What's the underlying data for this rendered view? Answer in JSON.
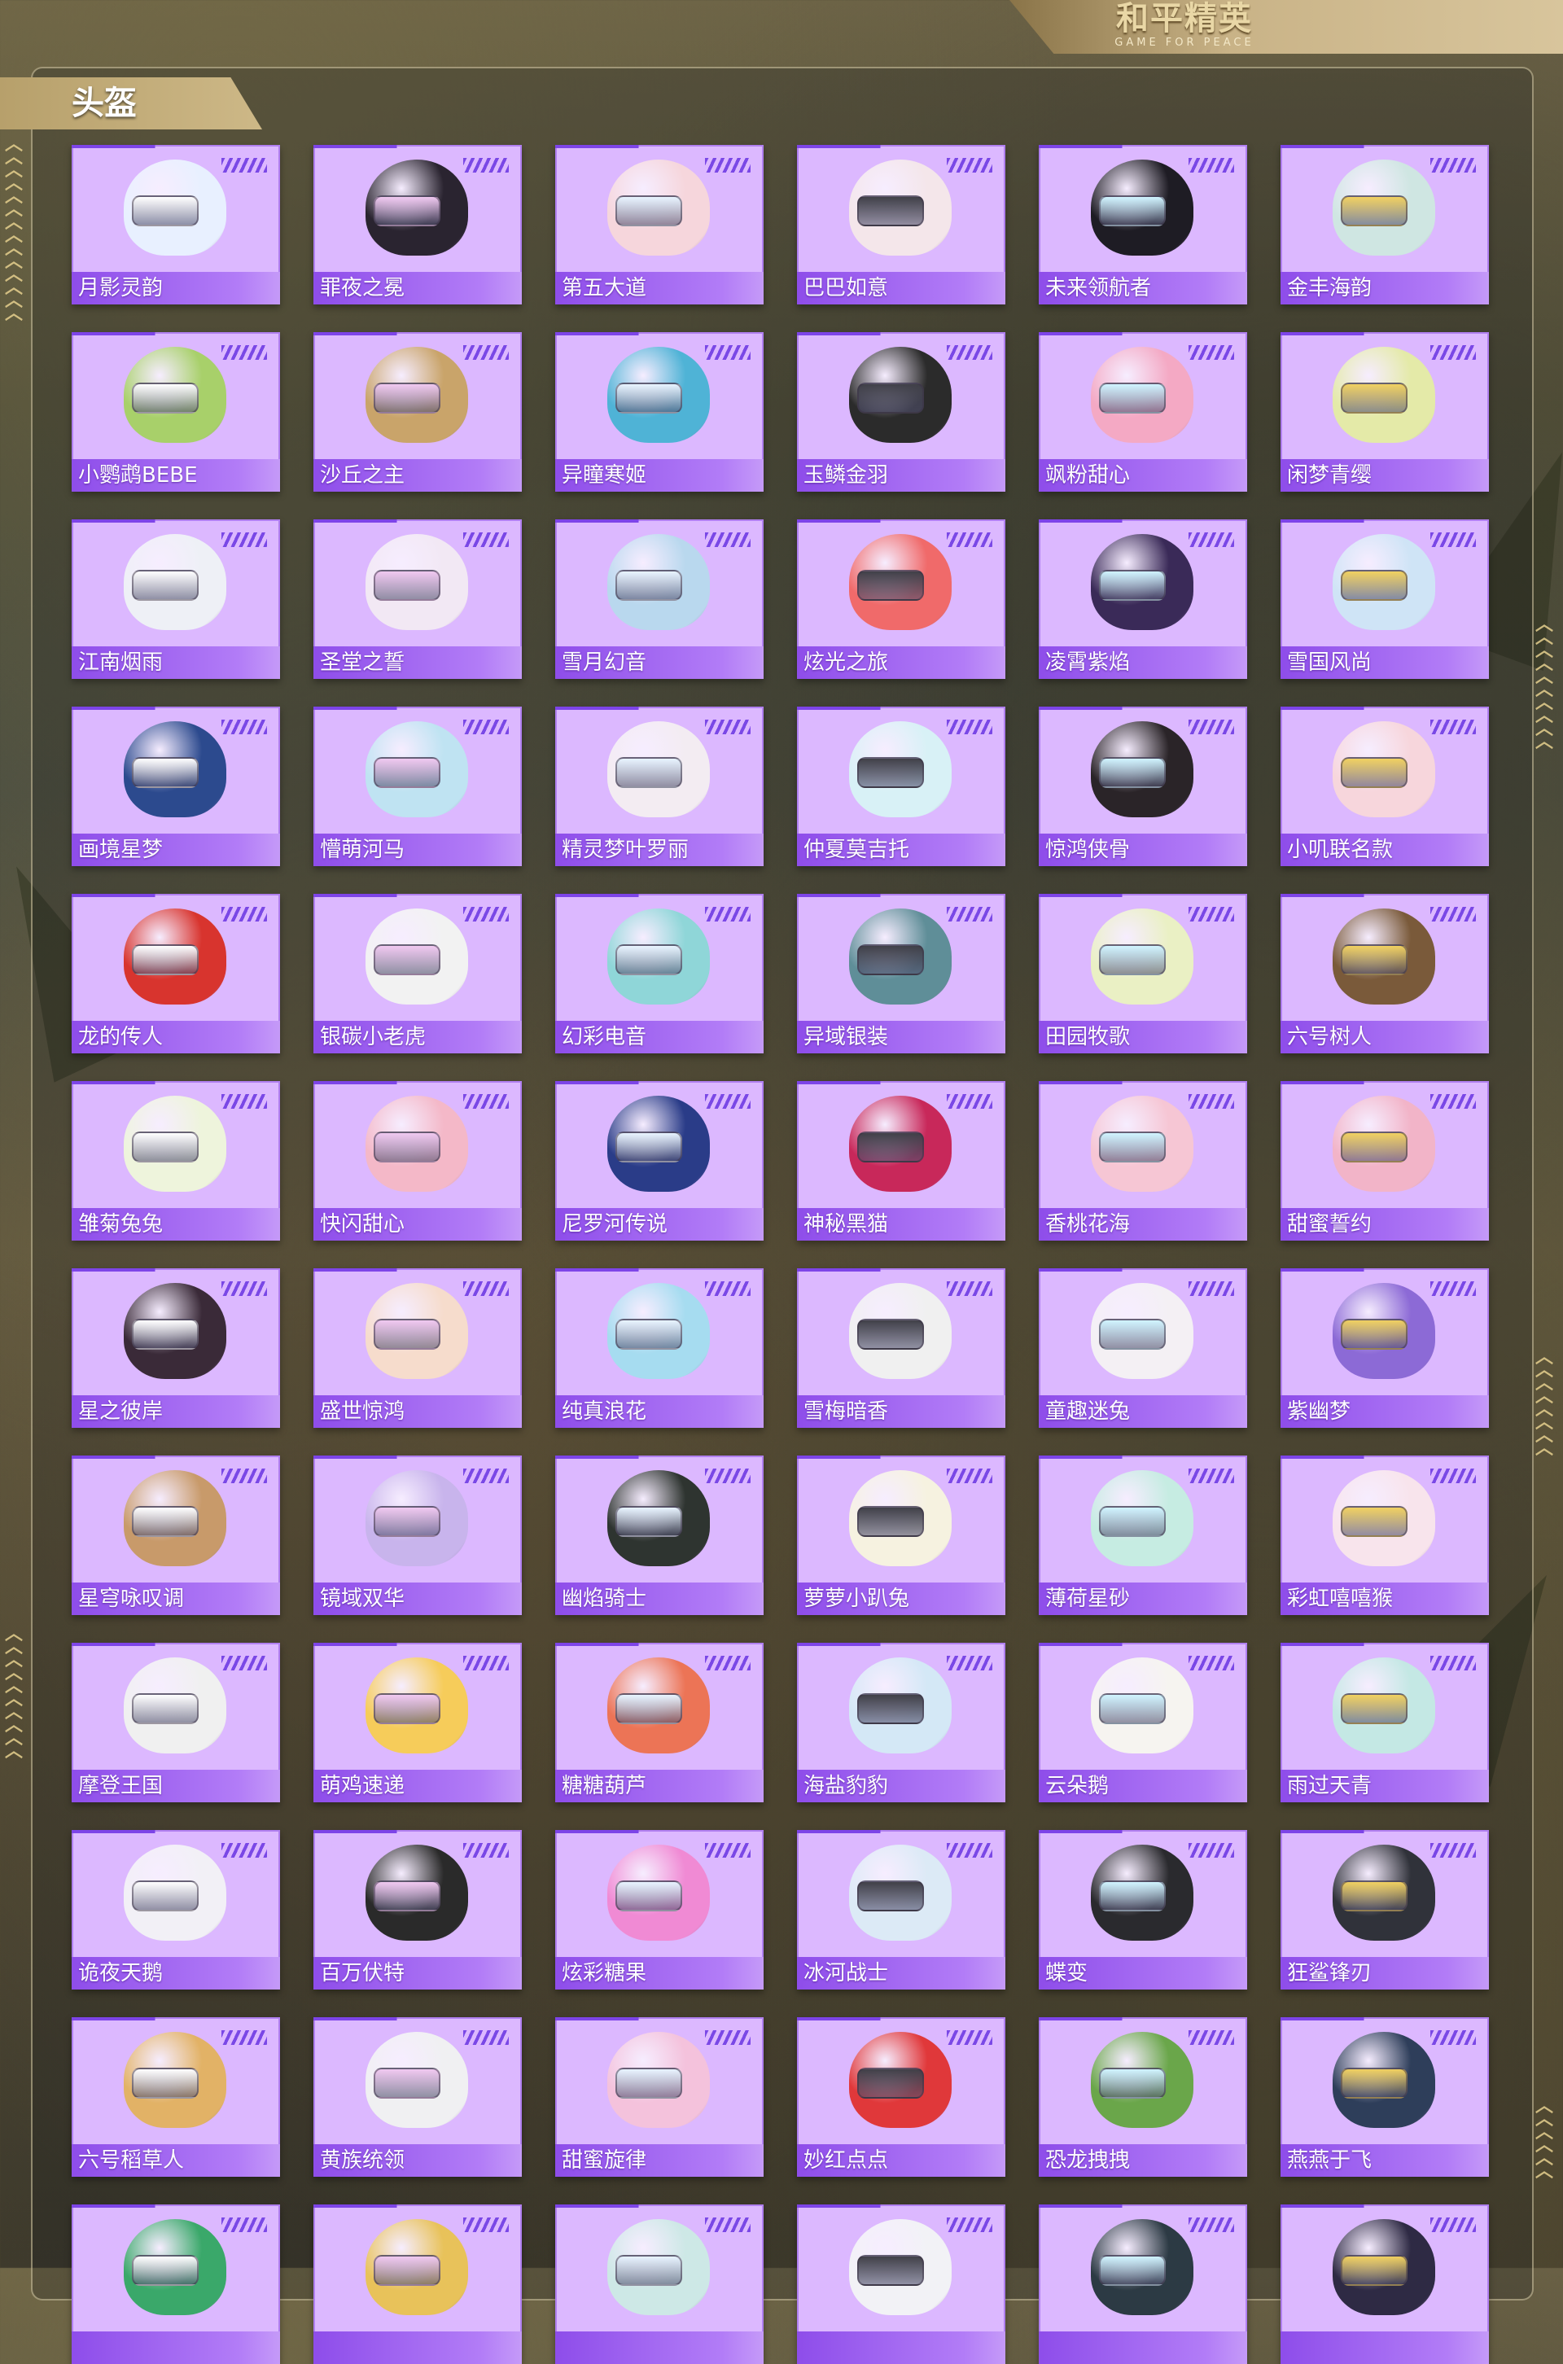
{
  "header": {
    "logo_cn": "和平精英",
    "logo_en": "GAME FOR PEACE"
  },
  "section": {
    "title": "头盔"
  },
  "helmets": [
    {
      "name": "月影灵韵",
      "color": "#e8f0ff"
    },
    {
      "name": "罪夜之冕",
      "color": "#2a2430"
    },
    {
      "name": "第五大道",
      "color": "#f6d6dc"
    },
    {
      "name": "巴巴如意",
      "color": "#f4e6ea"
    },
    {
      "name": "未来领航者",
      "color": "#1e1c24"
    },
    {
      "name": "金丰海韵",
      "color": "#cfe6e2"
    },
    {
      "name": "小鹦鹉BEBE",
      "color": "#a8d06a"
    },
    {
      "name": "沙丘之主",
      "color": "#c9a46a"
    },
    {
      "name": "异瞳寒姬",
      "color": "#4fb3d6"
    },
    {
      "name": "玉鳞金羽",
      "color": "#2b2b2b"
    },
    {
      "name": "飒粉甜心",
      "color": "#f4a9c4"
    },
    {
      "name": "闲梦青缨",
      "color": "#e4eaa8"
    },
    {
      "name": "江南烟雨",
      "color": "#eef0f6"
    },
    {
      "name": "圣堂之誓",
      "color": "#f2e8f4"
    },
    {
      "name": "雪月幻音",
      "color": "#b9d8ee"
    },
    {
      "name": "炫光之旅",
      "color": "#f06a6a"
    },
    {
      "name": "凌霄紫焰",
      "color": "#3a2a58"
    },
    {
      "name": "雪国风尚",
      "color": "#cfe4f6"
    },
    {
      "name": "画境星梦",
      "color": "#2c4a8e"
    },
    {
      "name": "懵萌河马",
      "color": "#bfe3f2"
    },
    {
      "name": "精灵梦叶罗丽",
      "color": "#f3ecf2"
    },
    {
      "name": "仲夏莫吉托",
      "color": "#d8f1f6"
    },
    {
      "name": "惊鸿侠骨",
      "color": "#2a2428"
    },
    {
      "name": "小叽联名款",
      "color": "#f7d6dc"
    },
    {
      "name": "龙的传人",
      "color": "#d8342e"
    },
    {
      "name": "银碳小老虎",
      "color": "#f2f2f2"
    },
    {
      "name": "幻彩电音",
      "color": "#8fd6d8"
    },
    {
      "name": "异域银装",
      "color": "#5f8e98"
    },
    {
      "name": "田园牧歌",
      "color": "#eaf0c4"
    },
    {
      "name": "六号树人",
      "color": "#7a5a3a"
    },
    {
      "name": "雏菊兔兔",
      "color": "#eef4dc"
    },
    {
      "name": "快闪甜心",
      "color": "#f4b8c8"
    },
    {
      "name": "尼罗河传说",
      "color": "#2a3c88"
    },
    {
      "name": "神秘黑猫",
      "color": "#c8285a"
    },
    {
      "name": "香桃花海",
      "color": "#f6c6d4"
    },
    {
      "name": "甜蜜誓约",
      "color": "#f2b4c8"
    },
    {
      "name": "星之彼岸",
      "color": "#3a2a38"
    },
    {
      "name": "盛世惊鸿",
      "color": "#f6dccc"
    },
    {
      "name": "纯真浪花",
      "color": "#a6dcf0"
    },
    {
      "name": "雪梅暗香",
      "color": "#f0f0f0"
    },
    {
      "name": "童趣迷兔",
      "color": "#f4f0f4"
    },
    {
      "name": "紫幽梦",
      "color": "#8c6ad6"
    },
    {
      "name": "星穹咏叹调",
      "color": "#c89a6a"
    },
    {
      "name": "镜域双华",
      "color": "#c8b4ec"
    },
    {
      "name": "幽焰骑士",
      "color": "#2e3430"
    },
    {
      "name": "萝萝小趴兔",
      "color": "#f6f2e0"
    },
    {
      "name": "薄荷星砂",
      "color": "#c6ece2"
    },
    {
      "name": "彩虹嘻嘻猴",
      "color": "#f8e4ec"
    },
    {
      "name": "摩登王国",
      "color": "#f0f0f0"
    },
    {
      "name": "萌鸡速递",
      "color": "#f6cc5a"
    },
    {
      "name": "糖糖葫芦",
      "color": "#ec7456"
    },
    {
      "name": "海盐豹豹",
      "color": "#d4e8f6"
    },
    {
      "name": "云朵鹅",
      "color": "#f6f4f0"
    },
    {
      "name": "雨过天青",
      "color": "#c4e8e4"
    },
    {
      "name": "诡夜天鹅",
      "color": "#f2f0f6"
    },
    {
      "name": "百万伏特",
      "color": "#2a2a2a"
    },
    {
      "name": "炫彩糖果",
      "color": "#f08ad4"
    },
    {
      "name": "冰河战士",
      "color": "#dceaf6"
    },
    {
      "name": "蝶变",
      "color": "#2a2a2e"
    },
    {
      "name": "狂鲨锋刃",
      "color": "#30323a"
    },
    {
      "name": "六号稻草人",
      "color": "#e2b266"
    },
    {
      "name": "黄族统领",
      "color": "#f0f0f2"
    },
    {
      "name": "甜蜜旋律",
      "color": "#f4c2dc"
    },
    {
      "name": "妙红点点",
      "color": "#e0383a"
    },
    {
      "name": "恐龙拽拽",
      "color": "#6aa64a"
    },
    {
      "name": "燕燕于飞",
      "color": "#2e3e5a"
    },
    {
      "name": "",
      "color": "#3aa86a"
    },
    {
      "name": "",
      "color": "#e8c25a"
    },
    {
      "name": "",
      "color": "#cde8e6"
    },
    {
      "name": "",
      "color": "#f2f2f6"
    },
    {
      "name": "",
      "color": "#2c3a44"
    },
    {
      "name": "",
      "color": "#2e2a44"
    }
  ],
  "visor_colors": [
    "#ffffff",
    "#f0c8f0",
    "#e8f4ff",
    "#404048",
    "#d0f4ff",
    "#f0d060"
  ]
}
